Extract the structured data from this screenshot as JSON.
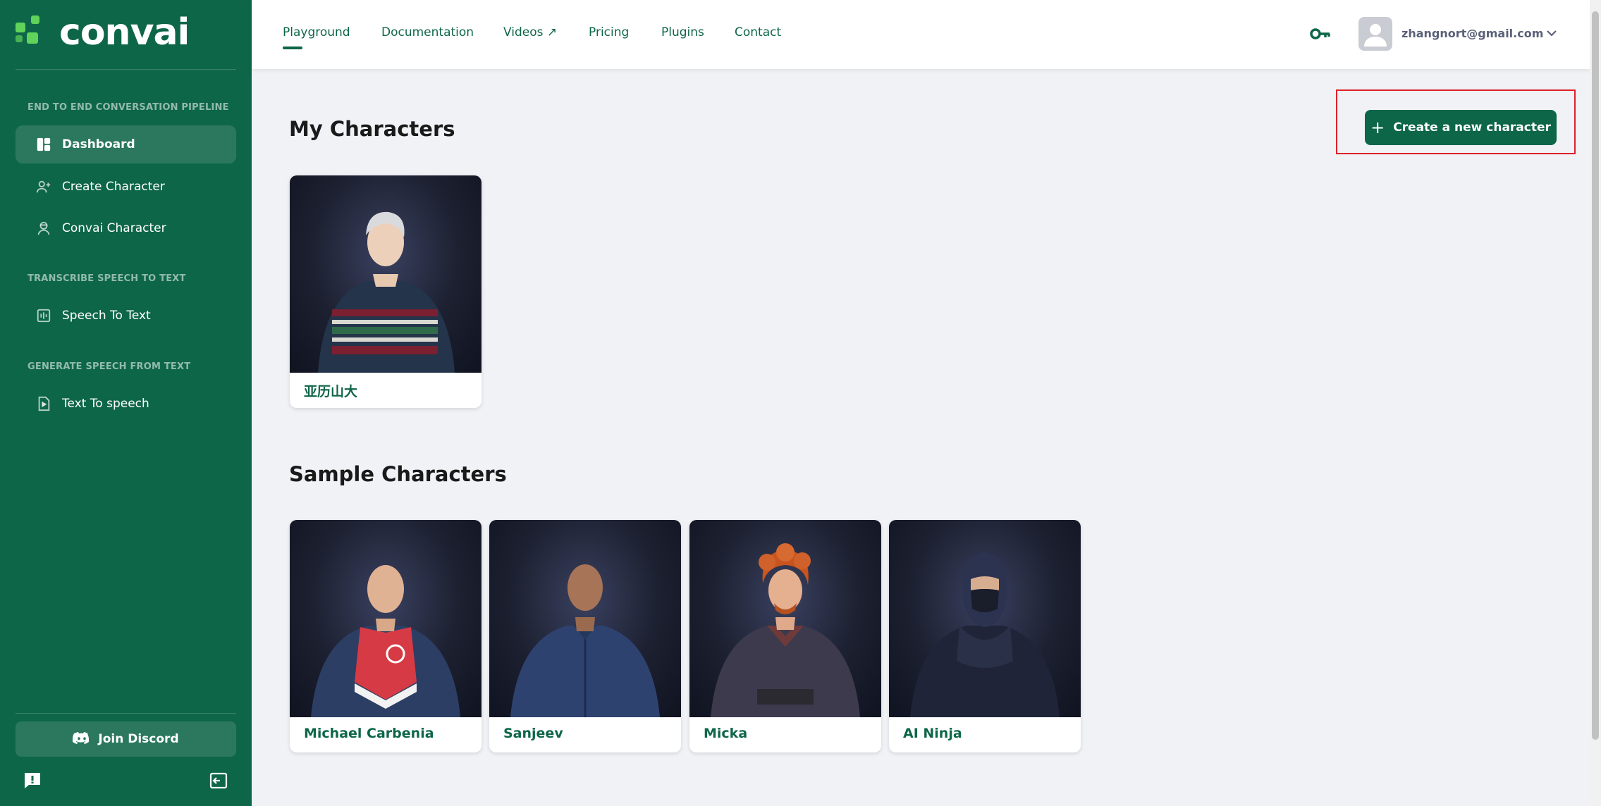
{
  "brand": {
    "name": "convai"
  },
  "sidebar": {
    "sections": [
      {
        "title": "END TO END CONVERSATION PIPELINE"
      },
      {
        "title": "TRANSCRIBE SPEECH TO TEXT"
      },
      {
        "title": "GENERATE SPEECH FROM TEXT"
      }
    ],
    "items": [
      {
        "label": "Dashboard",
        "icon": "dashboard-icon",
        "active": true
      },
      {
        "label": "Create Character",
        "icon": "add-user-icon"
      },
      {
        "label": "Convai Character",
        "icon": "character-icon"
      },
      {
        "label": "Speech To Text",
        "icon": "audio-wave-icon"
      },
      {
        "label": "Text To speech",
        "icon": "audio-file-icon"
      }
    ],
    "discord_label": "Join Discord"
  },
  "topnav": {
    "links": [
      {
        "label": "Playground",
        "active": true
      },
      {
        "label": "Documentation"
      },
      {
        "label": "Videos ↗"
      },
      {
        "label": "Pricing"
      },
      {
        "label": "Plugins"
      },
      {
        "label": "Contact"
      }
    ],
    "user_email": "zhangnort@gmail.com"
  },
  "main": {
    "my_characters_title": "My Characters",
    "create_button_label": "Create a new character",
    "my_characters": [
      {
        "name": "亚历山大"
      }
    ],
    "sample_characters_title": "Sample Characters",
    "sample_characters": [
      {
        "name": "Michael Carbenia"
      },
      {
        "name": "Sanjeev"
      },
      {
        "name": "Micka"
      },
      {
        "name": "AI Ninja"
      }
    ]
  },
  "colors": {
    "brand_green": "#0e6649",
    "logo_accent": "#5fd35a",
    "highlight_red": "#e0202a",
    "background": "#f0f2f6"
  }
}
